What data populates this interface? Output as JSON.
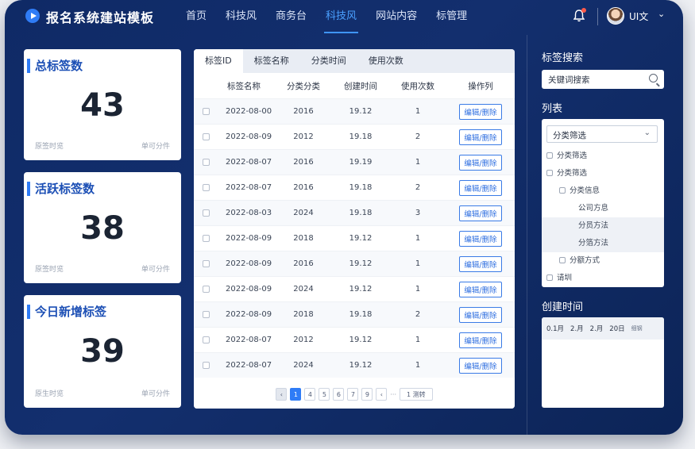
{
  "app": {
    "title": "报名系统建站模板"
  },
  "nav": [
    {
      "label": "首页",
      "active": false
    },
    {
      "label": "科技风",
      "active": false
    },
    {
      "label": "商务台",
      "active": false
    },
    {
      "label": "科技风",
      "active": true
    },
    {
      "label": "网站内容",
      "active": false
    },
    {
      "label": "标管理",
      "active": false
    }
  ],
  "user": {
    "name": "UI文",
    "notification_dot_color": "#ff5b4a"
  },
  "stats": [
    {
      "title": "总标签数",
      "value": "43",
      "left_note": "原签时览",
      "right_note": "单可分件"
    },
    {
      "title": "活跃标签数",
      "value": "38",
      "left_note": "原签时览",
      "right_note": "单可分件"
    },
    {
      "title": "今日新增标签",
      "value": "39",
      "left_note": "原生时览",
      "right_note": "单可分件"
    }
  ],
  "table": {
    "tabs": [
      {
        "label": "标签ID",
        "active": true
      },
      {
        "label": "标签名称",
        "active": false
      },
      {
        "label": "分类时间",
        "active": false
      },
      {
        "label": "使用次数",
        "active": false
      }
    ],
    "columns": [
      "标签名称",
      "分类分类",
      "创建时间",
      "使用次数",
      "操作列"
    ],
    "rows": [
      {
        "date": "2022-08-00",
        "category": "2016",
        "time": "19.12",
        "count": "1",
        "op": "编辑/删除"
      },
      {
        "date": "2022-08-09",
        "category": "2012",
        "time": "19.18",
        "count": "2",
        "op": "编辑/删除"
      },
      {
        "date": "2022-08-07",
        "category": "2016",
        "time": "19.19",
        "count": "1",
        "op": "编辑/删除"
      },
      {
        "date": "2022-08-07",
        "category": "2016",
        "time": "19.18",
        "count": "2",
        "op": "编辑/删除"
      },
      {
        "date": "2022-08-03",
        "category": "2024",
        "time": "19.18",
        "count": "3",
        "op": "编辑/删除"
      },
      {
        "date": "2022-08-09",
        "category": "2018",
        "time": "19.12",
        "count": "1",
        "op": "编辑/删除"
      },
      {
        "date": "2022-08-09",
        "category": "2016",
        "time": "19.12",
        "count": "1",
        "op": "编辑/删除"
      },
      {
        "date": "2022-08-09",
        "category": "2024",
        "time": "19.12",
        "count": "1",
        "op": "编辑/删除"
      },
      {
        "date": "2022-08-09",
        "category": "2018",
        "time": "19.18",
        "count": "2",
        "op": "编辑/删除"
      },
      {
        "date": "2022-08-07",
        "category": "2012",
        "time": "19.12",
        "count": "1",
        "op": "编辑/删除"
      },
      {
        "date": "2022-08-07",
        "category": "2024",
        "time": "19.12",
        "count": "1",
        "op": "编辑/删除"
      }
    ],
    "pager": {
      "prev": "‹",
      "pages": [
        "1",
        "4",
        "5",
        "6",
        "7",
        "9"
      ],
      "active_page": "1",
      "next": "‹",
      "dots": "···",
      "jump": "1 测转"
    }
  },
  "sidebar": {
    "search_label": "标签搜索",
    "search_value": "关键词搜索",
    "list_label": "列表",
    "select_value": "分类筛选",
    "tree": [
      {
        "label": "分类筛选",
        "level": 0,
        "checkbox": true,
        "highlight": false
      },
      {
        "label": "分类筛选",
        "level": 0,
        "checkbox": true,
        "highlight": false
      },
      {
        "label": "分类信息",
        "level": 1,
        "checkbox": true,
        "highlight": false
      },
      {
        "label": "公司方息",
        "level": 2,
        "checkbox": false,
        "highlight": false
      },
      {
        "label": "分员方法",
        "level": 2,
        "checkbox": false,
        "highlight": true
      },
      {
        "label": "分箔方法",
        "level": 2,
        "checkbox": false,
        "highlight": true
      },
      {
        "label": "分额方式",
        "level": 1,
        "checkbox": true,
        "highlight": false
      },
      {
        "label": "请圳",
        "level": 0,
        "checkbox": true,
        "highlight": false
      }
    ],
    "time_label": "创建时间",
    "time_options": [
      "0.1月",
      "2.月",
      "2.月",
      "20日",
      "细钢"
    ]
  },
  "colors": {
    "accent": "#2f7cf6",
    "frame_bg": "#12306e",
    "card_title": "#1c4fb5"
  }
}
